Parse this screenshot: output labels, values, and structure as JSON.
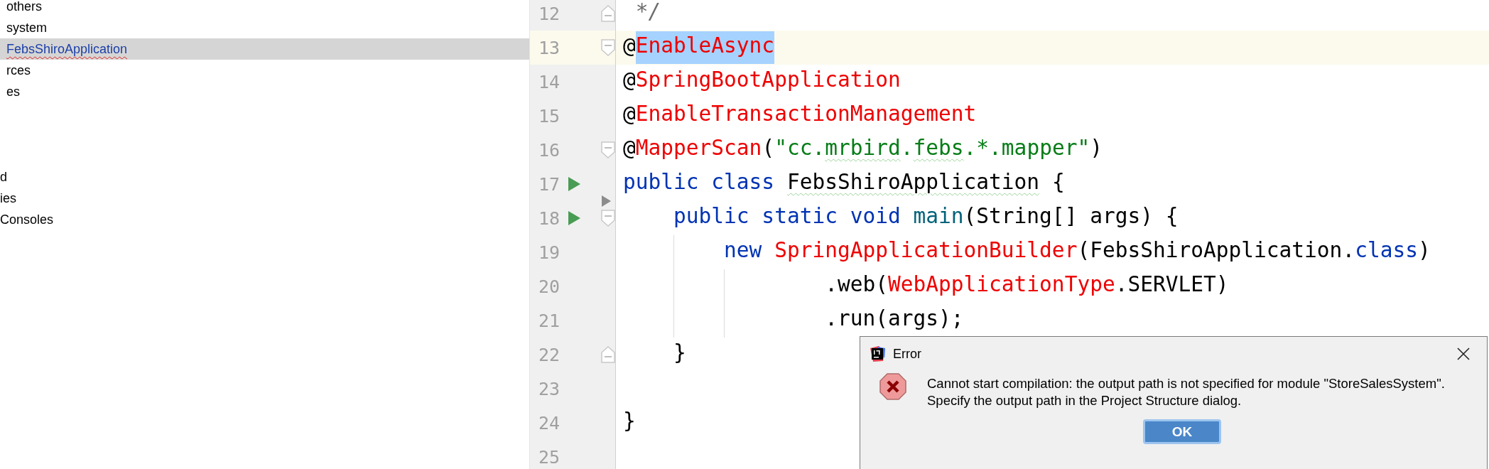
{
  "project_tree": {
    "upper_items": [
      {
        "label": "others",
        "selected": false,
        "modified": false,
        "error": false
      },
      {
        "label": "system",
        "selected": false,
        "modified": false,
        "error": false
      },
      {
        "label": "FebsShiroApplication",
        "selected": true,
        "modified": true,
        "error": true
      },
      {
        "label": "rces",
        "selected": false,
        "modified": false,
        "error": false
      },
      {
        "label": "es",
        "selected": false,
        "modified": false,
        "error": false
      }
    ],
    "lower_items": [
      {
        "label": "d",
        "selected": false,
        "modified": false,
        "error": false
      },
      {
        "label": "ies",
        "selected": false,
        "modified": false,
        "error": false
      },
      {
        "label": "Consoles",
        "selected": false,
        "modified": false,
        "error": false
      }
    ]
  },
  "editor": {
    "lines": [
      {
        "number": "12",
        "current": false,
        "run": false,
        "fold": true,
        "tokens": [
          {
            "kind": "comment",
            "text": " */"
          }
        ]
      },
      {
        "number": "13",
        "current": true,
        "run": false,
        "fold": true,
        "tokens": [
          {
            "kind": "plain",
            "text": "@",
            "selected": false
          },
          {
            "kind": "annotation",
            "text": "EnableAsync",
            "selected": true
          }
        ]
      },
      {
        "number": "14",
        "current": false,
        "run": false,
        "fold": false,
        "tokens": [
          {
            "kind": "plain",
            "text": "@"
          },
          {
            "kind": "annotation",
            "text": "SpringBootApplication"
          }
        ]
      },
      {
        "number": "15",
        "current": false,
        "run": false,
        "fold": false,
        "tokens": [
          {
            "kind": "plain",
            "text": "@"
          },
          {
            "kind": "annotation",
            "text": "EnableTransactionManagement"
          }
        ]
      },
      {
        "number": "16",
        "current": false,
        "run": false,
        "fold": true,
        "tokens": [
          {
            "kind": "plain",
            "text": "@"
          },
          {
            "kind": "annotation",
            "text": "MapperScan"
          },
          {
            "kind": "plain",
            "text": "("
          },
          {
            "kind": "string",
            "text": "\"cc."
          },
          {
            "kind": "string",
            "text": "mrbird",
            "typo": true
          },
          {
            "kind": "string",
            "text": "."
          },
          {
            "kind": "string",
            "text": "febs",
            "typo": true
          },
          {
            "kind": "string",
            "text": ".*.mapper\""
          },
          {
            "kind": "plain",
            "text": ")"
          }
        ]
      },
      {
        "number": "17",
        "current": false,
        "run": true,
        "fold": false,
        "tokens": [
          {
            "kind": "keyword",
            "text": "public class "
          },
          {
            "kind": "plain",
            "text": "FebsShiroApplication",
            "typo": true
          },
          {
            "kind": "plain",
            "text": " {"
          }
        ]
      },
      {
        "number": "18",
        "current": false,
        "run": true,
        "fold": true,
        "tokens": [
          {
            "kind": "keyword",
            "text": "    public static void "
          },
          {
            "kind": "method",
            "text": "main"
          },
          {
            "kind": "plain",
            "text": "(String[] args) {"
          }
        ]
      },
      {
        "number": "19",
        "current": false,
        "run": false,
        "fold": false,
        "tokens": [
          {
            "kind": "keyword",
            "text": "        new "
          },
          {
            "kind": "annotation",
            "text": "SpringApplicationBuilder"
          },
          {
            "kind": "plain",
            "text": "(FebsShiroApplication."
          },
          {
            "kind": "keyword",
            "text": "class"
          },
          {
            "kind": "plain",
            "text": ")"
          }
        ]
      },
      {
        "number": "20",
        "current": false,
        "run": false,
        "fold": false,
        "tokens": [
          {
            "kind": "plain",
            "text": "                .web("
          },
          {
            "kind": "annotation",
            "text": "WebApplicationType"
          },
          {
            "kind": "plain",
            "text": ".SERVLET)"
          }
        ]
      },
      {
        "number": "21",
        "current": false,
        "run": false,
        "fold": false,
        "tokens": [
          {
            "kind": "plain",
            "text": "                .run(args);"
          }
        ]
      },
      {
        "number": "22",
        "current": false,
        "run": false,
        "fold": true,
        "tokens": [
          {
            "kind": "plain",
            "text": "    }"
          }
        ]
      },
      {
        "number": "23",
        "current": false,
        "run": false,
        "fold": false
      },
      {
        "number": "24",
        "current": false,
        "run": false,
        "fold": false,
        "tokens": [
          {
            "kind": "plain",
            "text": "}"
          }
        ]
      },
      {
        "number": "25",
        "current": false,
        "run": false,
        "fold": false
      }
    ]
  },
  "dialog": {
    "title": "Error",
    "message_lines": [
      "Cannot start compilation: the output path is not specified for module \"StoreSalesSystem\".",
      "Specify the output path in the Project Structure dialog."
    ],
    "button": "OK"
  }
}
